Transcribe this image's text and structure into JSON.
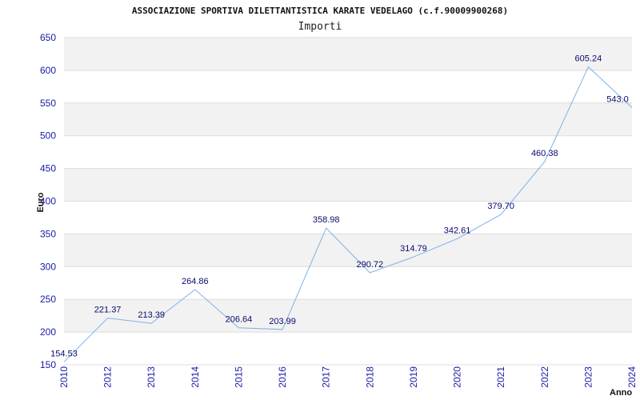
{
  "chart_data": {
    "type": "line",
    "title": "ASSOCIAZIONE SPORTIVA DILETTANTISTICA KARATE VEDELAGO (c.f.90009900268)",
    "subtitle": "Importi",
    "xlabel": "Anno",
    "ylabel": "Euro",
    "categories": [
      "2010",
      "2012",
      "2013",
      "2014",
      "2015",
      "2016",
      "2017",
      "2018",
      "2019",
      "2020",
      "2021",
      "2022",
      "2023",
      "2024"
    ],
    "values": [
      154.53,
      221.37,
      213.39,
      264.86,
      206.64,
      203.99,
      358.98,
      290.72,
      314.79,
      342.61,
      379.7,
      460.38,
      605.24,
      543.0
    ],
    "value_labels": [
      "154.53",
      "221.37",
      "213.39",
      "264.86",
      "206.64",
      "203.99",
      "358.98",
      "290.72",
      "314.79",
      "342.61",
      "379.70",
      "460.38",
      "605.24",
      "543.0"
    ],
    "y_ticks": [
      "150",
      "200",
      "250",
      "300",
      "350",
      "400",
      "450",
      "500",
      "550",
      "600",
      "650"
    ],
    "ylim": [
      150,
      650
    ],
    "grid": true,
    "colors": {
      "line": "#7fb2e5",
      "band": "#f2f2f2",
      "grid": "#dcdcdc",
      "tick_text": "#1a1aa6",
      "label_text": "#0a0a6e"
    }
  }
}
